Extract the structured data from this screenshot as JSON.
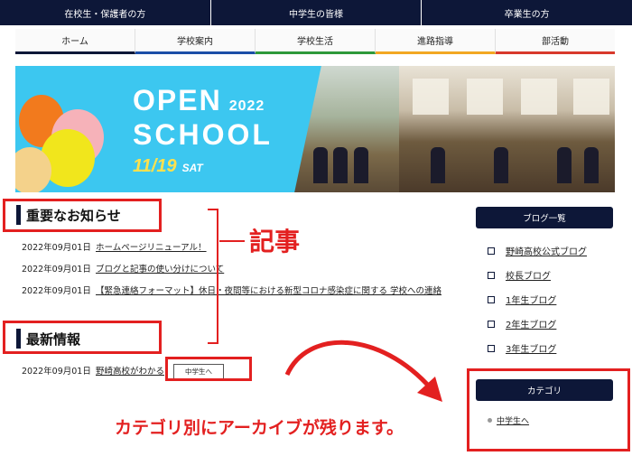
{
  "top_nav": [
    "在校生・保護者の方",
    "中学生の皆様",
    "卒業生の方"
  ],
  "main_nav": [
    {
      "label": "ホーム",
      "color": "#0d1738"
    },
    {
      "label": "学校案内",
      "color": "#1c4fa8"
    },
    {
      "label": "学校生活",
      "color": "#2e9a3b"
    },
    {
      "label": "進路指導",
      "color": "#f2a823"
    },
    {
      "label": "部活動",
      "color": "#d8392c"
    }
  ],
  "hero": {
    "line1": "OPEN",
    "year": "2022",
    "line2": "SCHOOL",
    "date_num": "11/19",
    "day": "SAT"
  },
  "important": {
    "title": "重要なお知らせ",
    "items": [
      {
        "date": "2022年09月01日",
        "text": "ホームページリニューアル！"
      },
      {
        "date": "2022年09月01日",
        "text": "ブログと記事の使い分けについて"
      },
      {
        "date": "2022年09月01日",
        "text": "【緊急連絡フォーマット】休日・夜間等における新型コロナ感染症に関する 学校への連絡"
      }
    ]
  },
  "latest": {
    "title": "最新情報",
    "items": [
      {
        "date": "2022年09月01日",
        "text": "野崎高校がわかる",
        "tag": "中学生へ"
      }
    ]
  },
  "annotation": {
    "label": "記事",
    "note": "カテゴリ別にアーカイブが残ります。",
    "color": "#e32020"
  },
  "sidebar": {
    "blog_title": "ブログ一覧",
    "blogs": [
      "野崎高校公式ブログ",
      "校長ブログ",
      "1年生ブログ",
      "2年生ブログ",
      "3年生ブログ"
    ],
    "category_title": "カテゴリ",
    "categories": [
      "中学生へ"
    ]
  }
}
